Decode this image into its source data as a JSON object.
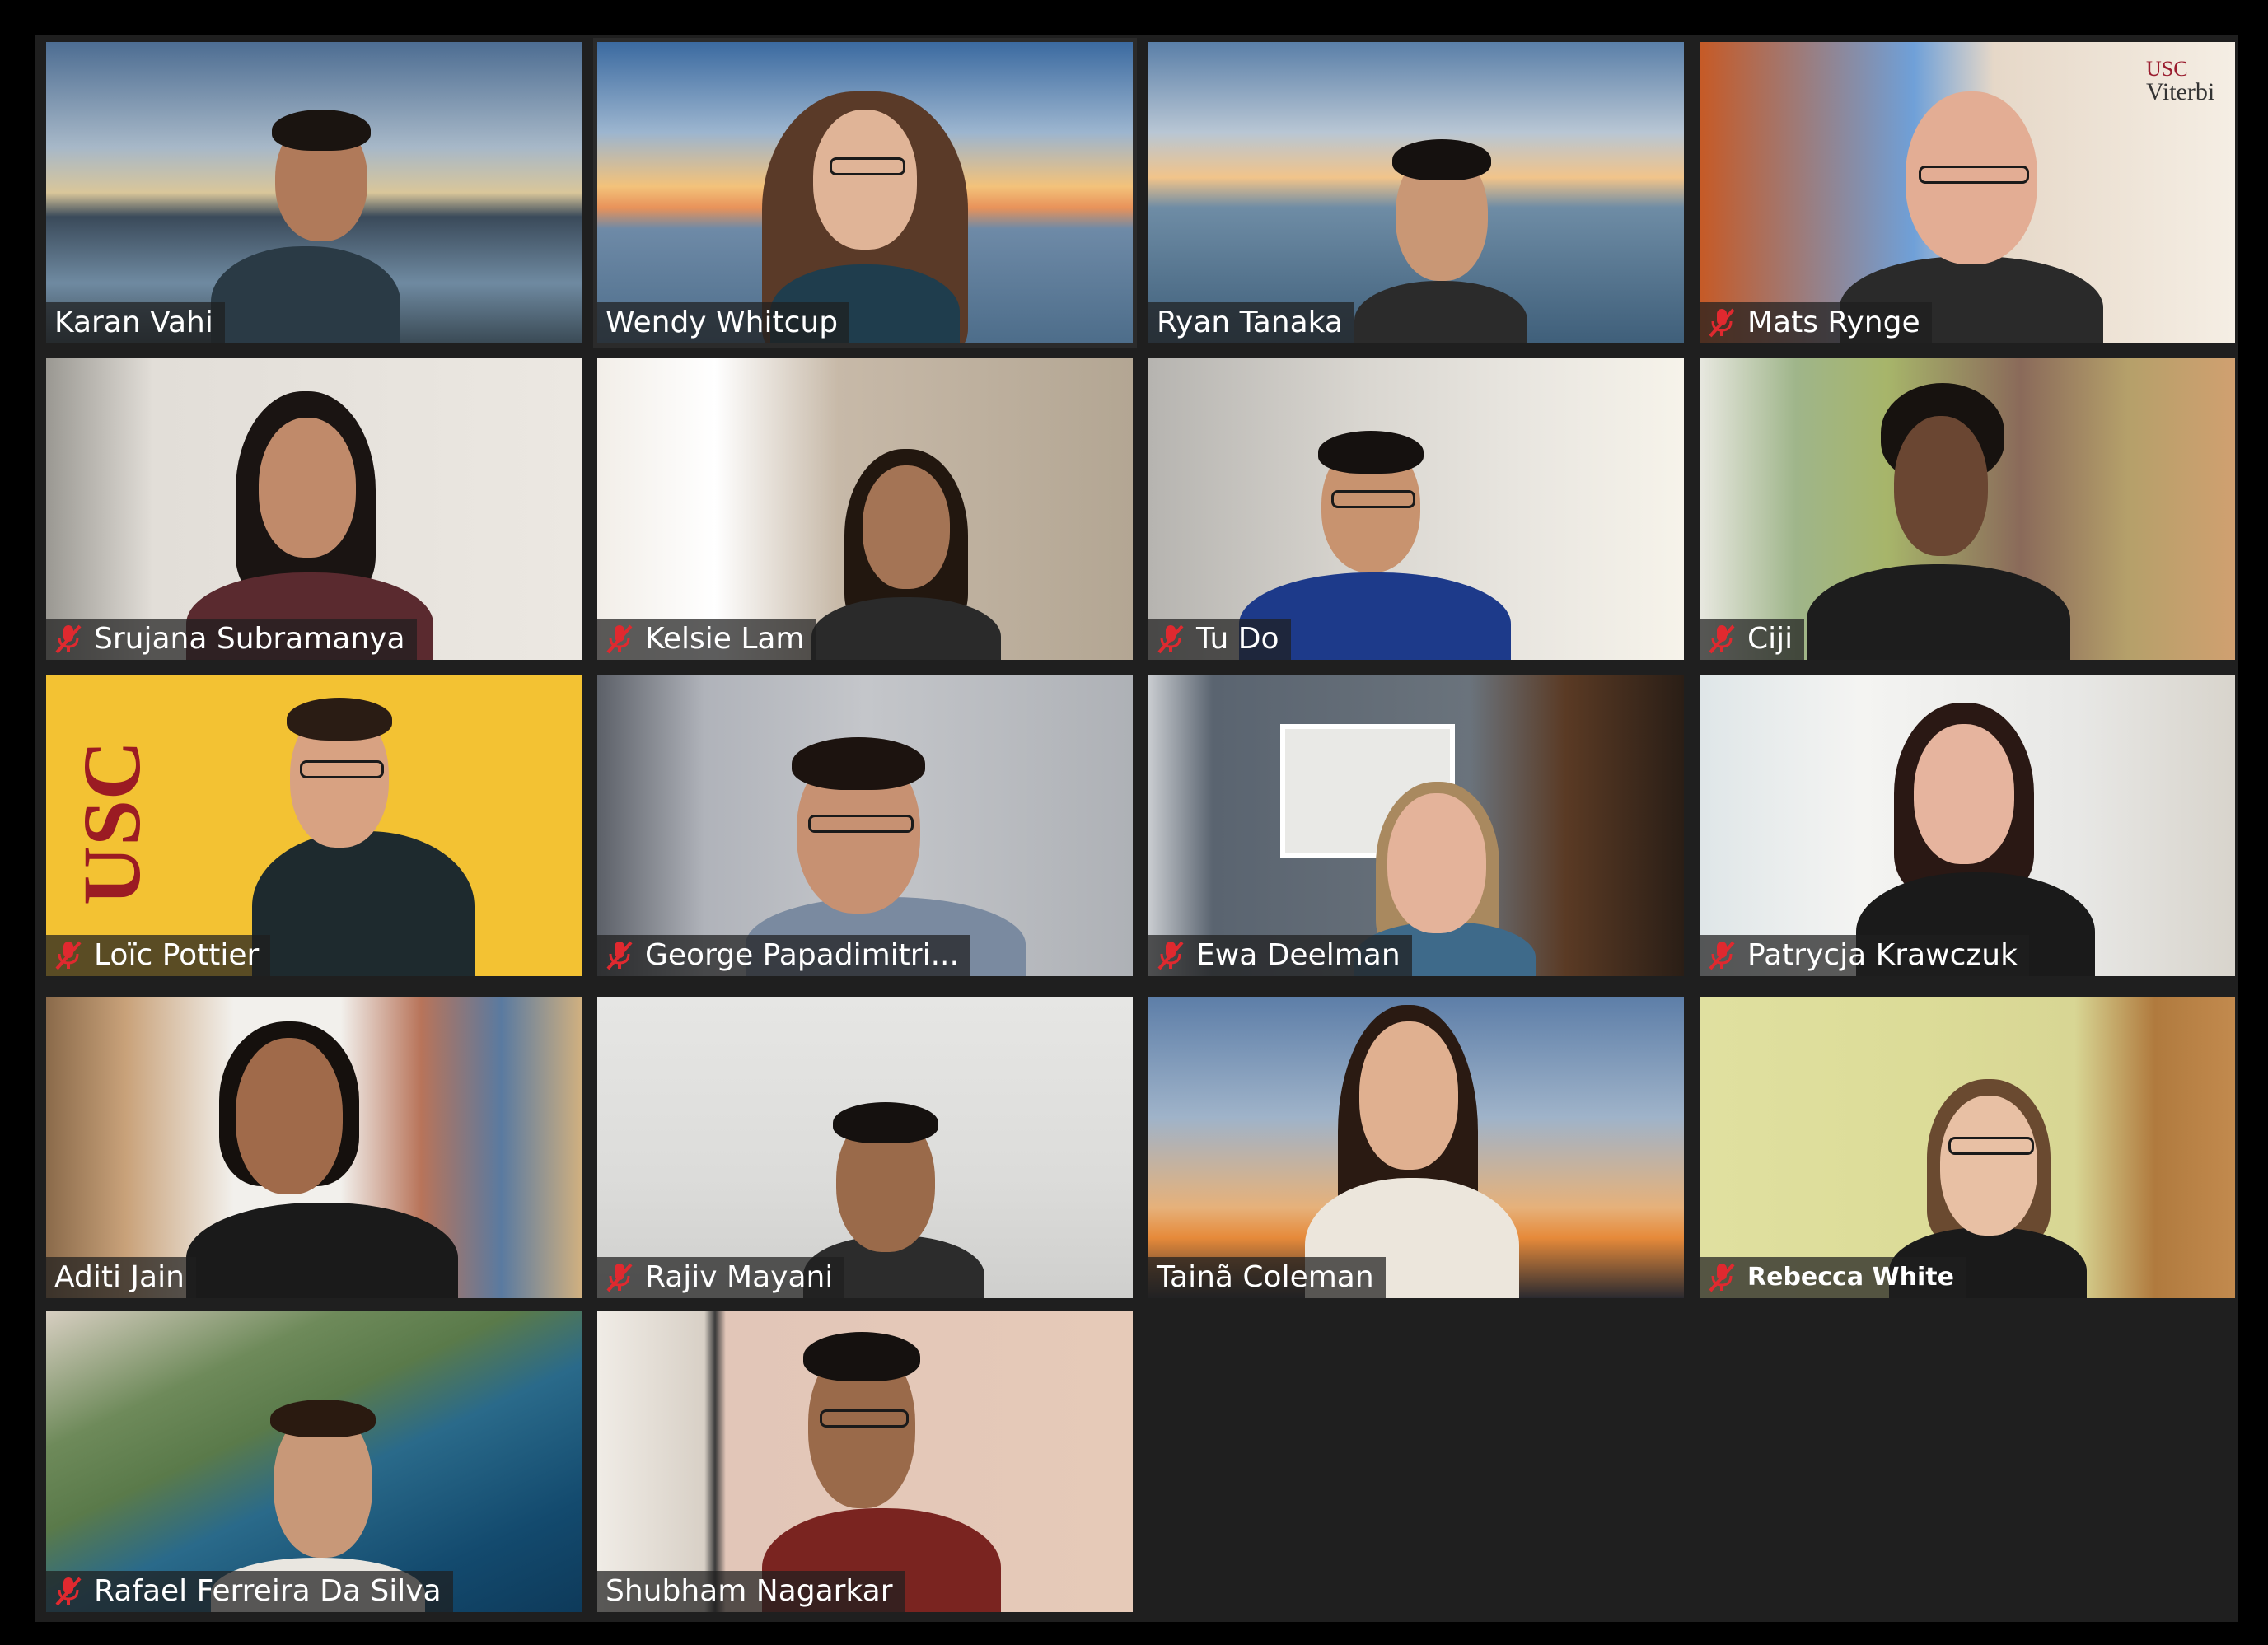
{
  "app": {
    "background": "#1f1f1f",
    "muted_icon_color": "#e0292f"
  },
  "participants": [
    {
      "name": "Karan Vahi",
      "muted": false
    },
    {
      "name": "Wendy Whitcup",
      "muted": false
    },
    {
      "name": "Ryan Tanaka",
      "muted": false
    },
    {
      "name": "Mats Rynge",
      "muted": true
    },
    {
      "name": "Srujana Subramanya",
      "muted": true
    },
    {
      "name": "Kelsie Lam",
      "muted": true
    },
    {
      "name": "Tu Do",
      "muted": true
    },
    {
      "name": "Ciji",
      "muted": true
    },
    {
      "name": "Loïc Pottier",
      "muted": true
    },
    {
      "name": "George Papadimitri...",
      "muted": true
    },
    {
      "name": "Ewa Deelman",
      "muted": true
    },
    {
      "name": "Patrycja Krawczuk",
      "muted": true
    },
    {
      "name": "Aditi Jain",
      "muted": false
    },
    {
      "name": "Rajiv Mayani",
      "muted": true
    },
    {
      "name": "Tainã Coleman",
      "muted": false
    },
    {
      "name": "Rebecca White",
      "muted": true
    },
    {
      "name": "Rafael Ferreira Da Silva",
      "muted": true
    },
    {
      "name": "Shubham Nagarkar",
      "muted": false
    }
  ],
  "backgrounds": {
    "usc_text": "USC",
    "viterbi_usc": "USC",
    "viterbi_name": "Viterbi"
  }
}
